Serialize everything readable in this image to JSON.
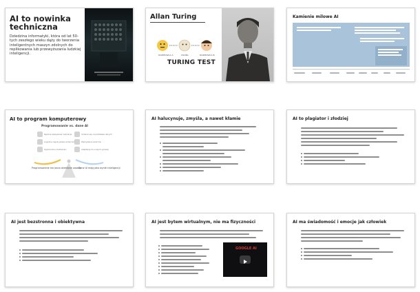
{
  "slides": [
    {
      "title": "AI to nowinka techniczna",
      "body": "Dziedzina informatyki, która od lat 50-tych zeszłego wieku dąży do tworzenia inteligentnych maszyn zdolnych do replikowania lub przewyższania ludzkiej inteligencji."
    },
    {
      "title": "Allan Turing",
      "diagram_title": "TURING TEST",
      "labels": [
        "ROZMÓWCA A",
        "OSOBA",
        "ROZMÓWCA B"
      ]
    },
    {
      "title": "Kamienie milowe AI"
    },
    {
      "title": "AI to program komputerowy",
      "subtitle": "Programowanie vs. dane AI",
      "left_items": [
        "Ręcznie wpisywane instrukcje",
        "Logiczne reguły pisane przez ludzi",
        "Ograniczone możliwości"
      ],
      "right_items": [
        "Uczenie się na podstawie danych",
        "Wykrywanie wzorców",
        "Adaptacja do nowych sytuacji"
      ],
      "bottom_left": "Programowanie ma jasno określone zasady",
      "bottom_right": "Dane AI mają jako wyniki inteligencji"
    },
    {
      "title": "AI halucynuje, zmyśla, a nawet kłamie"
    },
    {
      "title": "AI to plagiator i złodziej"
    },
    {
      "title": "AI jest bezstronna i obiektywna"
    },
    {
      "title": "AI jest bytem wirtualnym, nie ma fizyczności",
      "video_title": "GOOGLE AI"
    },
    {
      "title": "AI ma świadomość i emocje jak człowiek"
    }
  ],
  "colors": {
    "milestone_blue": "#a9c3da",
    "timeline_gray": "#c9c9c9",
    "accent_yellow": "#f2c12e"
  }
}
